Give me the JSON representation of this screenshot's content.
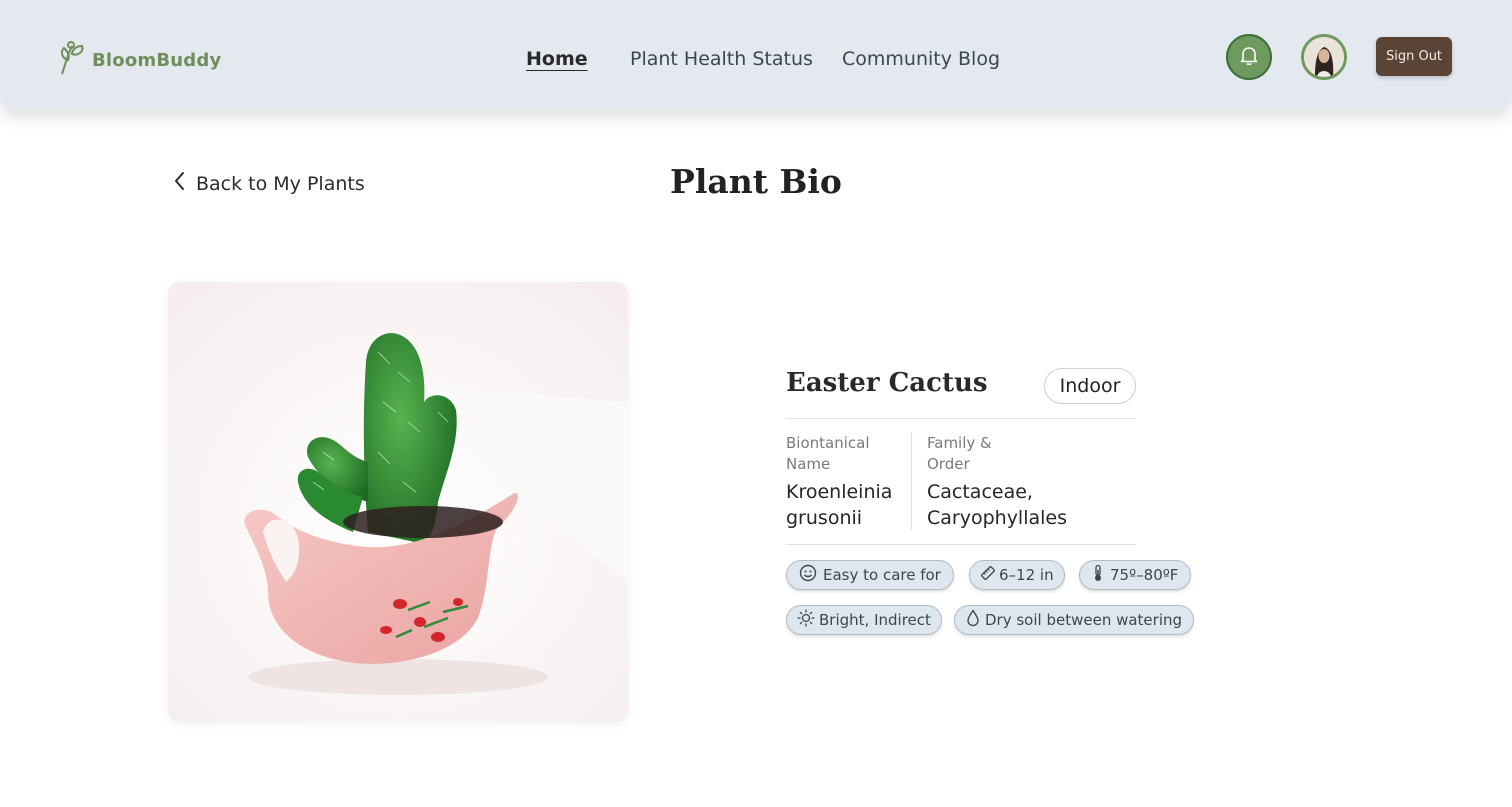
{
  "brand": {
    "name": "BloomBuddy",
    "logo_icon": "sprout-icon",
    "color": "#6e8f5b"
  },
  "nav": {
    "links": [
      {
        "label": "Home",
        "active": true
      },
      {
        "label": "Plant Health Status",
        "active": false
      },
      {
        "label": "Community Blog",
        "active": false
      }
    ]
  },
  "header_actions": {
    "notifications_icon": "bell-icon",
    "avatar_icon": "user-avatar",
    "signout_label": "Sign Out"
  },
  "back_link": {
    "label": "Back to My Plants",
    "icon": "chevron-left-icon"
  },
  "page": {
    "title": "Plant Bio"
  },
  "plant": {
    "name": "Easter Cactus",
    "location_tag": "Indoor",
    "botanical_label": "Biontanical Name",
    "botanical_value": "Kroenleinia grusonii",
    "family_label": "Family & Order",
    "family_value": "Cactaceae, Caryophyllales",
    "photo": "pink-pitcher-cactus-photo",
    "care_tags": [
      {
        "icon": "smiley-icon",
        "label": "Easy to care for"
      },
      {
        "icon": "ruler-icon",
        "label": "6–12 in"
      },
      {
        "icon": "thermometer-icon",
        "label": "75º–80ºF"
      },
      {
        "icon": "sun-icon",
        "label": "Bright, Indirect"
      },
      {
        "icon": "droplet-icon",
        "label": "Dry soil between watering"
      }
    ]
  },
  "colors": {
    "header_bg": "#e3e9ef",
    "accent_green": "#6e9a5f",
    "signout_bg": "#5a4436",
    "chip_bg": "#dfe7ee"
  }
}
